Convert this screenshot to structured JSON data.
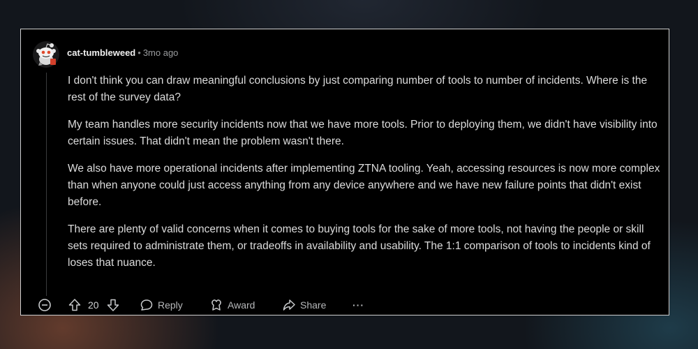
{
  "comment": {
    "username": "cat-tumbleweed",
    "separator": "•",
    "timestamp": "3mo ago",
    "paragraphs": [
      "I don't think you can draw meaningful conclusions by just comparing number of tools to number of incidents. Where is the rest of the survey data?",
      "My team handles more security incidents now that we have more tools. Prior to deploying them, we didn't have visibility into certain issues. That didn't mean the problem wasn't there.",
      "We also have more operational incidents after implementing ZTNA tooling. Yeah, accessing resources is now more complex than when anyone could just access anything from any device anywhere and we have new failure points that didn't exist before.",
      "There are plenty of valid concerns when it comes to buying tools for the sake of more tools, not having the people or skill sets required to administrate them, or tradeoffs in availability and usability. The 1:1 comparison of tools to incidents kind of loses that nuance."
    ]
  },
  "actions": {
    "vote_count": "20",
    "reply_label": "Reply",
    "award_label": "Award",
    "share_label": "Share",
    "more_label": "···"
  },
  "icons": {
    "avatar": "snoo-avatar-icon",
    "collapse": "collapse-icon",
    "upvote": "upvote-arrow-icon",
    "downvote": "downvote-arrow-icon",
    "reply": "speech-bubble-icon",
    "award": "award-icon",
    "share": "share-arrow-icon",
    "more": "more-options-icon"
  }
}
